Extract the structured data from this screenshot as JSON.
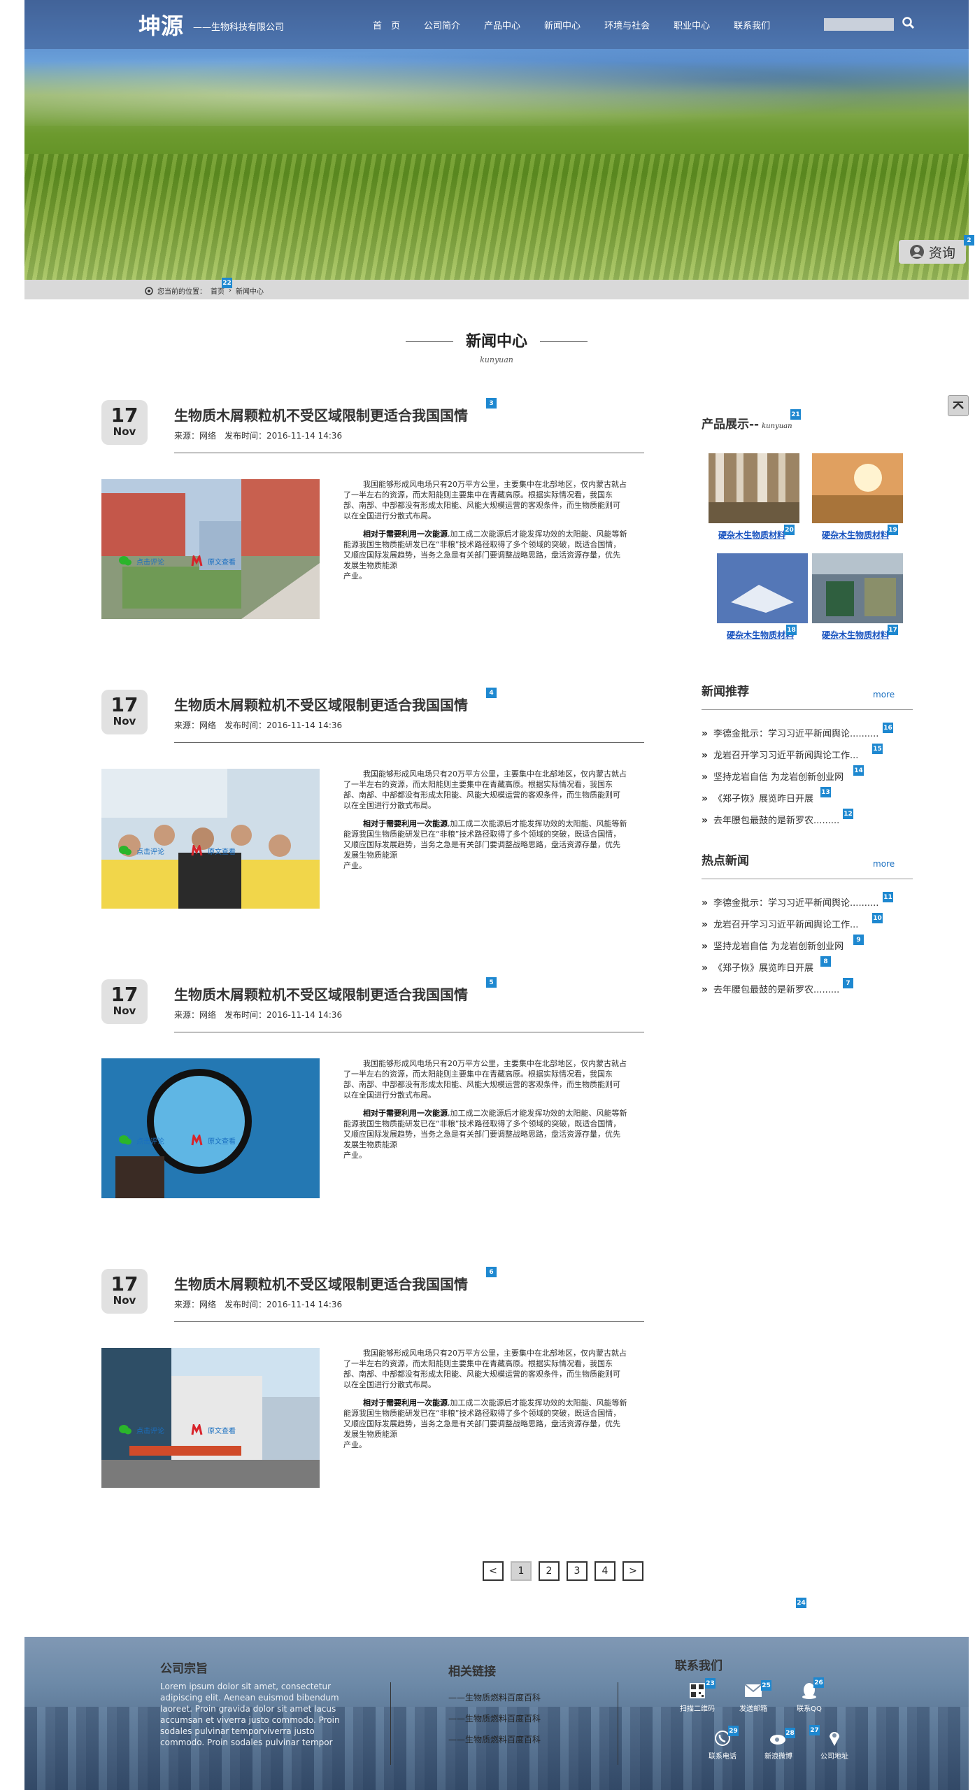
{
  "header": {
    "logo": "坤源",
    "logo_sub": "——生物科技有限公司",
    "nav": [
      "首　页",
      "公司简介",
      "产品中心",
      "新闻中心",
      "环境与社会",
      "职业中心",
      "联系我们"
    ],
    "search_placeholder": ""
  },
  "consult_label": "资询",
  "breadcrumb": {
    "prefix": "您当前的位置：",
    "home": "首页",
    "current": "新闻中心"
  },
  "section": {
    "title": "新闻中心",
    "subtitle": "kunyuan"
  },
  "articles": [
    {
      "day": "17",
      "month": "Nov",
      "title": "生物质木屑颗粒机不受区域限制更适合我国国情",
      "meta": "来源：网络　发布时间：2016-11-14 14:36"
    },
    {
      "day": "17",
      "month": "Nov",
      "title": "生物质木屑颗粒机不受区域限制更适合我国国情",
      "meta": "来源：网络　发布时间：2016-11-14 14:36"
    },
    {
      "day": "17",
      "month": "Nov",
      "title": "生物质木屑颗粒机不受区域限制更适合我国国情",
      "meta": "来源：网络　发布时间：2016-11-14 14:36"
    },
    {
      "day": "17",
      "month": "Nov",
      "title": "生物质木屑颗粒机不受区域限制更适合我国国情",
      "meta": "来源：网络　发布时间：2016-11-14 14:36"
    }
  ],
  "article_body": {
    "p1": "我国能够形成风电场只有20万平方公里，主要集中在北部地区，仅内蒙古就占了一半左右的资源，而太阳能则主要集中在青藏高原。根据实际情况看，我国东部、南部、中部都没有形成太阳能、风能大规模运营的客观条件，而生物质能则可以在全国进行分散式布局。",
    "p2_bold": "相对于需要利用一次能源",
    "p2_rest": ",加工成二次能源后才能发挥功效的太阳能、风能等新能源我国生物质能研发已在“非粮”技术路径取得了多个领域的突破，既适合国情，又顺应国际发展趋势，当务之急是有关部门要调整战略思路，盘活资源存量，优先发展生物质能源",
    "p2_end": "产业。",
    "comment_label": "点击评论",
    "view_label": "原文查看"
  },
  "pager": {
    "prev": "<",
    "pages": [
      "1",
      "2",
      "3",
      "4"
    ],
    "next": ">"
  },
  "sidebar": {
    "products_title": "产品展示--",
    "products_sub": "kunyuan",
    "products": [
      "硬杂木生物质材料",
      "硬杂木生物质材料",
      "硬杂木生物质材料",
      "硬杂木生物质材料"
    ],
    "news_title": "新闻推荐",
    "hot_title": "热点新闻",
    "more": "more",
    "news": [
      "李德金批示：学习习近平新闻舆论..........",
      "龙岩召开学习习近平新闻舆论工作...",
      "坚持龙岩自信 为龙岩创新创业网",
      "《郑子恢》展览昨日开展",
      "去年腰包最鼓的是新罗农........."
    ],
    "hot": [
      "李德金批示：学习习近平新闻舆论..........",
      "龙岩召开学习习近平新闻舆论工作...",
      "坚持龙岩自信 为龙岩创新创业网",
      "《郑子恢》展览昨日开展",
      "去年腰包最鼓的是新罗农........."
    ]
  },
  "footer": {
    "about_title": "公司宗旨",
    "about_text": "Lorem ipsum dolor sit amet, consectetur adipiscing elit. Aenean euismod bibendum laoreet. Proin gravida dolor sit amet lacus accumsan et viverra justo commodo. Proin sodales pulvinar temporviverra justo commodo. Proin sodales pulvinar tempor",
    "links_title": "相关链接",
    "links": [
      "——生物质燃料百度百科",
      "——生物质燃料百度百科",
      "——生物质燃料百度百科"
    ],
    "contact_title": "联系我们",
    "contact": [
      "扫描二维码",
      "发送邮箱",
      "联系QQ",
      "联系电话",
      "新浪微博",
      "公司地址"
    ]
  },
  "badges": [
    "2",
    "22",
    "3",
    "4",
    "5",
    "6",
    "21",
    "20",
    "19",
    "18",
    "17",
    "16",
    "15",
    "14",
    "13",
    "12",
    "11",
    "10",
    "9",
    "8",
    "7",
    "24",
    "23",
    "25",
    "26",
    "29",
    "28",
    "27"
  ],
  "colors": {
    "accent": "#1e88d0",
    "link": "#1a6fc0",
    "banner_bar": "#3c5a8c"
  }
}
